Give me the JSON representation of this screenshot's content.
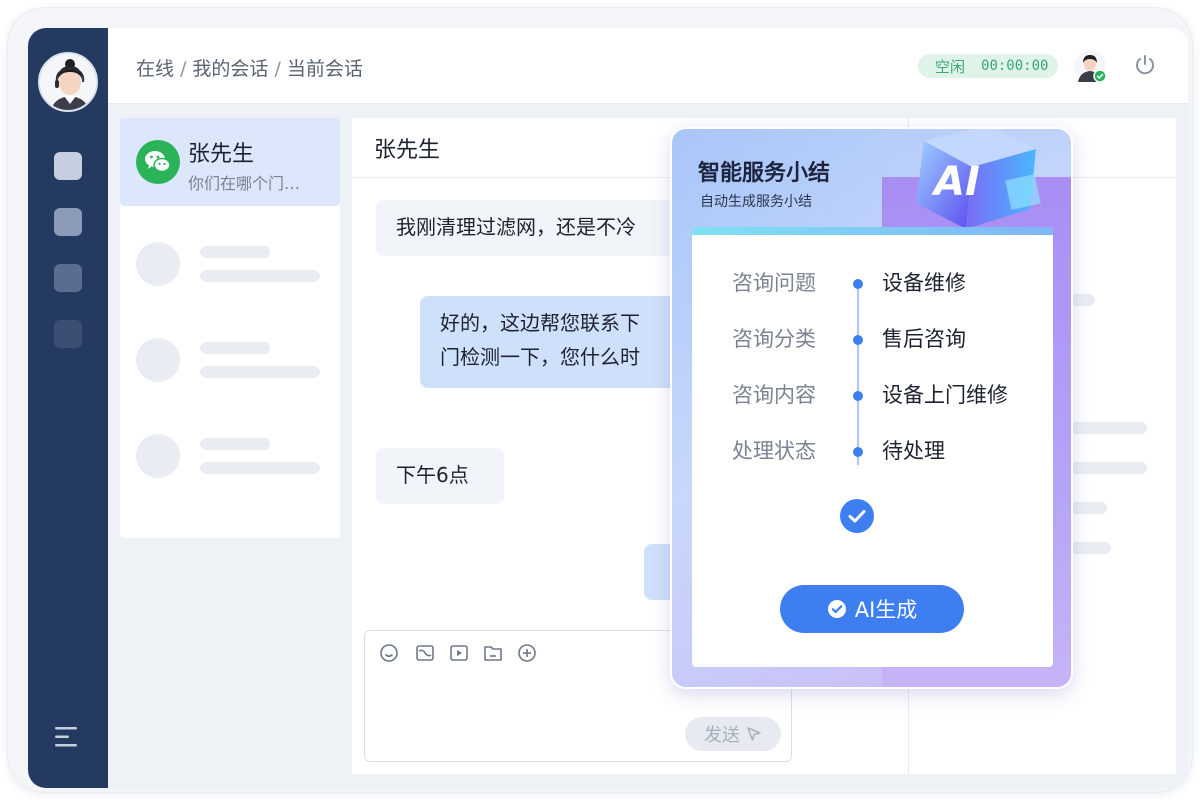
{
  "breadcrumb": [
    "在线",
    "我的会话",
    "当前会话"
  ],
  "status": {
    "label": "空闲",
    "timer": "00:00:00"
  },
  "nav_icons": [
    "user-avatar",
    "nav-item-1",
    "nav-item-2",
    "nav-item-3",
    "nav-item-4",
    "menu-icon"
  ],
  "contacts": {
    "active": {
      "name": "张先生",
      "preview": "你们在哪个门…",
      "channel_icon": "wechat-icon"
    }
  },
  "chat": {
    "title": "张先生",
    "messages": [
      {
        "dir": "in",
        "text": "我刚清理过滤网，还是不冷"
      },
      {
        "dir": "out",
        "text": "好的，这边帮您联系下"
      },
      {
        "dir": "out",
        "text": "门检测一下，您什么时"
      },
      {
        "dir": "in",
        "text": "下午6点"
      }
    ],
    "toolbar_icons": [
      "emoji-icon",
      "image-icon",
      "video-icon",
      "folder-icon",
      "plus-icon"
    ],
    "send_label": "发送"
  },
  "ai_summary": {
    "title": "智能服务小结",
    "subtitle": "自动生成服务小结",
    "badge": "AI",
    "fields": [
      {
        "label": "咨询问题",
        "value": "设备维修"
      },
      {
        "label": "咨询分类",
        "value": "售后咨询"
      },
      {
        "label": "咨询内容",
        "value": "设备上门维修"
      },
      {
        "label": "处理状态",
        "value": "待处理"
      }
    ],
    "button_label": "AI生成"
  },
  "colors": {
    "sidebar": "#253a60",
    "accent": "#3d7ff0",
    "status_green": "#3aa775",
    "wechat": "#2bb35a"
  }
}
